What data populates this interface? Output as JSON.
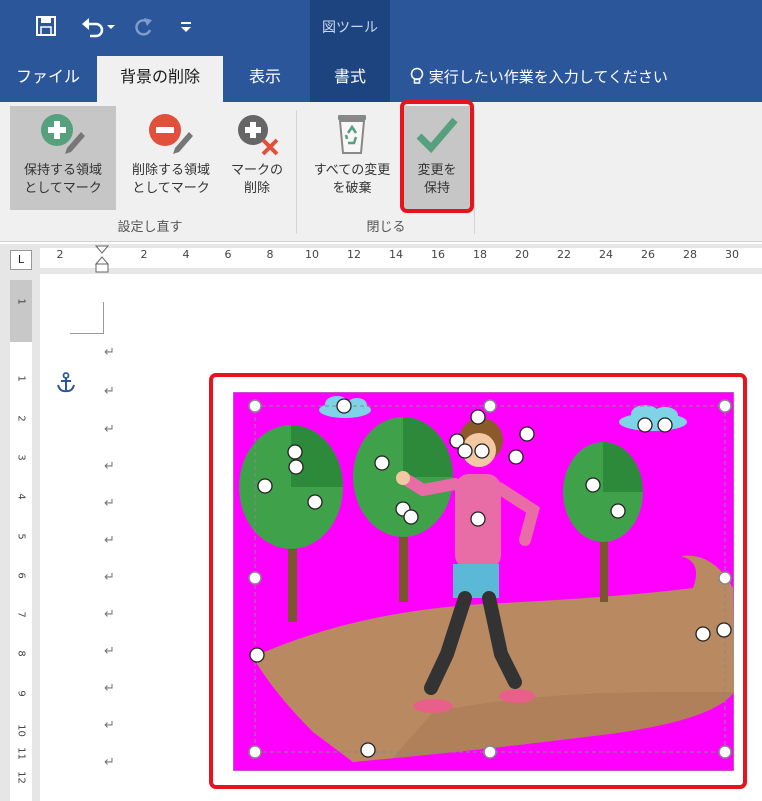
{
  "quick_access": {
    "save_icon": "save-icon",
    "undo_icon": "undo-icon",
    "redo_icon": "redo-icon",
    "customize_icon": "customize-quick-access-icon"
  },
  "context_tool": {
    "label": "図ツール"
  },
  "tabs": {
    "file": "ファイル",
    "background_removal": "背景の削除",
    "view": "表示",
    "format": "書式"
  },
  "tell_me": {
    "text": "実行したい作業を入力してください",
    "icon": "lightbulb-icon"
  },
  "ribbon": {
    "refine_group": {
      "label": "設定し直す",
      "keep_line1": "保持する領域",
      "keep_line2": "としてマーク",
      "remove_line1": "削除する領域",
      "remove_line2": "としてマーク",
      "delete_mark_line1": "マークの",
      "delete_mark_line2": "削除"
    },
    "close_group": {
      "label": "閉じる",
      "discard_line1": "すべての変更",
      "discard_line2": "を破棄",
      "keep_changes_line1": "変更を",
      "keep_changes_line2": "保持"
    },
    "colors": {
      "green": "#56a07e",
      "red": "#e0503a",
      "highlight": "#e8141c"
    }
  },
  "ruler": {
    "corner": "L",
    "h_labels": [
      "2",
      "2",
      "4",
      "6",
      "8",
      "10",
      "12",
      "14",
      "16",
      "18",
      "20",
      "22",
      "24",
      "26",
      "28",
      "30"
    ],
    "v_labels": [
      "1",
      "1",
      "2",
      "3",
      "4",
      "5",
      "6",
      "7",
      "8",
      "9",
      "10",
      "11",
      "12"
    ]
  },
  "document": {
    "paragraph_mark": "↵",
    "anchor_icon": "anchor-icon",
    "picture": {
      "background_color": "#ff00ff",
      "path_color": "#b98a62"
    }
  }
}
